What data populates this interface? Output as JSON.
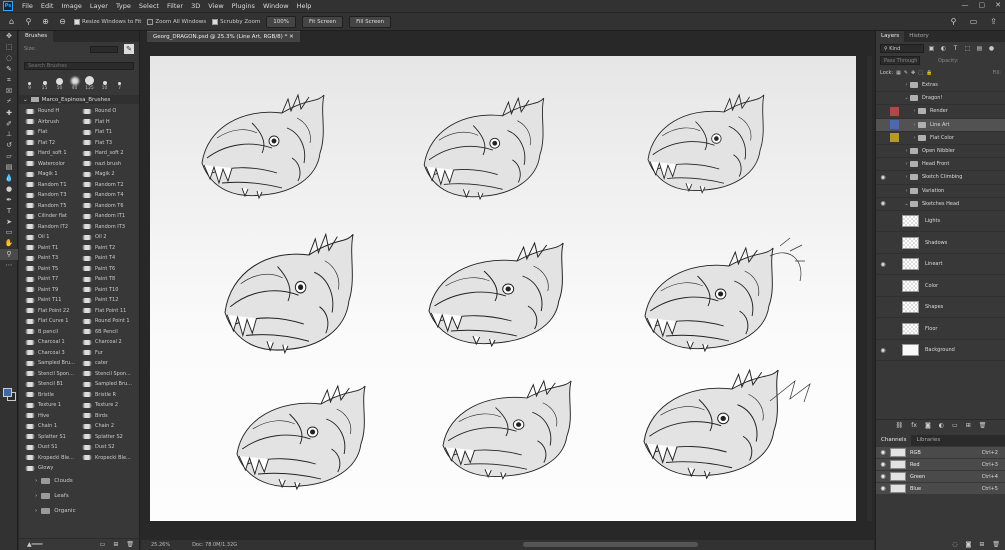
{
  "menu": {
    "logo": "Ps",
    "items": [
      "File",
      "Edit",
      "Image",
      "Layer",
      "Type",
      "Select",
      "Filter",
      "3D",
      "View",
      "Plugins",
      "Window",
      "Help"
    ]
  },
  "options": {
    "resize_windows": "Resize Windows to Fit",
    "zoom_all": "Zoom All Windows",
    "scrubby": "Scrubby Zoom",
    "zoom_pct": "100%",
    "fit_screen": "Fit Screen",
    "fill_screen": "Fill Screen"
  },
  "brushes": {
    "tab": "Brushes",
    "size_label": "Size:",
    "search_placeholder": "Search Brushes",
    "preset_sizes": [
      "9",
      "15",
      "50",
      "40",
      "125",
      "10",
      "7"
    ],
    "group": "Marco_Espinosa_Brushes",
    "items": [
      "Round H",
      "Round O",
      "Airbrush",
      "Flat H",
      "Flat",
      "Flat T1",
      "Flat T2",
      "Flat T3",
      "Hard_soft 1",
      "Hard_soft 2",
      "Watercolor",
      "nazi brush",
      "Magik 1",
      "Magik 2",
      "Random T1",
      "Random T2",
      "Random T3",
      "Random T4",
      "Random T5",
      "Random T6",
      "Cilinder flat",
      "Random IT1",
      "Random IT2",
      "Random IT3",
      "Oil 1",
      "Oil 2",
      "Paint T1",
      "Paint T2",
      "Paint T3",
      "Paint T4",
      "Paint T5",
      "Paint T6",
      "Paint T7",
      "Paint T8",
      "Paint T9",
      "Paint T10",
      "Paint T11",
      "Paint T12",
      "Flat Point 22",
      "Flat Point 11",
      "Flat Curve 1",
      "Round Point 1",
      "B pencil",
      "6B Pencil",
      "Charcoal 1",
      "Charcoal 2",
      "Charcoal 3",
      "Fur",
      "Sampled Bru...",
      "cater",
      "Stencil Spon...",
      "Stencil Spon...",
      "Stencil B1",
      "Sampled Bru...",
      "Bristle",
      "Bristle R",
      "Texture 1",
      "Texture 2",
      "Hive",
      "Birds",
      "Chain 1",
      "Chain 2",
      "Splatter S1",
      "Splatter S2",
      "Dust S1",
      "Dust S2",
      "Kropecki Ble...",
      "Kropecki Ble...",
      "Glowy"
    ],
    "folders": [
      "Clouds",
      "Leafs",
      "Organic"
    ]
  },
  "document": {
    "tab_title": "Georg_DRAGON.psd @ 25.3% (Line Art, RGB/8) *",
    "zoom": "25.26%",
    "doc_size": "Doc: 78.0M/1.32G"
  },
  "layers_panel": {
    "tabs": [
      "Layers",
      "History"
    ],
    "kind": "Kind",
    "blend_mode": "Pass Through",
    "opacity_label": "Opacity:",
    "lock_label": "Lock:",
    "fill_label": "Fill:",
    "layers": [
      {
        "name": "Extras",
        "type": "group",
        "visible": false,
        "depth": 0,
        "color": ""
      },
      {
        "name": "Dragon!",
        "type": "group",
        "visible": false,
        "depth": 0,
        "color": "",
        "open": true
      },
      {
        "name": "Render",
        "type": "group",
        "visible": false,
        "depth": 1,
        "color": "#b34646"
      },
      {
        "name": "Line Art",
        "type": "group",
        "visible": false,
        "depth": 1,
        "color": "#4b6aa6",
        "selected": true
      },
      {
        "name": "Flat Color",
        "type": "group",
        "visible": false,
        "depth": 1,
        "color": "#b59a2a"
      },
      {
        "name": "Open Nibbler",
        "type": "group",
        "visible": false,
        "depth": 0,
        "color": ""
      },
      {
        "name": "Head Front",
        "type": "group",
        "visible": false,
        "depth": 0,
        "color": ""
      },
      {
        "name": "Sketch Climbing",
        "type": "group",
        "visible": true,
        "depth": 0,
        "color": ""
      },
      {
        "name": "Variation",
        "type": "group",
        "visible": false,
        "depth": 0,
        "color": ""
      },
      {
        "name": "Sketches Head",
        "type": "group",
        "visible": true,
        "depth": 0,
        "color": "",
        "open": true
      }
    ],
    "sublayers": [
      {
        "name": "Lights",
        "visible": false
      },
      {
        "name": "Shadows",
        "visible": false
      },
      {
        "name": "Lineart",
        "visible": true
      },
      {
        "name": "Color",
        "visible": false
      },
      {
        "name": "Shapes",
        "visible": false
      },
      {
        "name": "Floor",
        "visible": false
      },
      {
        "name": "Background",
        "visible": true
      }
    ]
  },
  "channels_panel": {
    "tabs": [
      "Channels",
      "Libraries"
    ],
    "channels": [
      {
        "name": "RGB",
        "shortcut": "Ctrl+2"
      },
      {
        "name": "Red",
        "shortcut": "Ctrl+3"
      },
      {
        "name": "Green",
        "shortcut": "Ctrl+4"
      },
      {
        "name": "Blue",
        "shortcut": "Ctrl+5"
      }
    ]
  },
  "colors": {
    "accent": "#31a8ff",
    "panel": "#383838",
    "canvas": "#f2f2f2"
  }
}
